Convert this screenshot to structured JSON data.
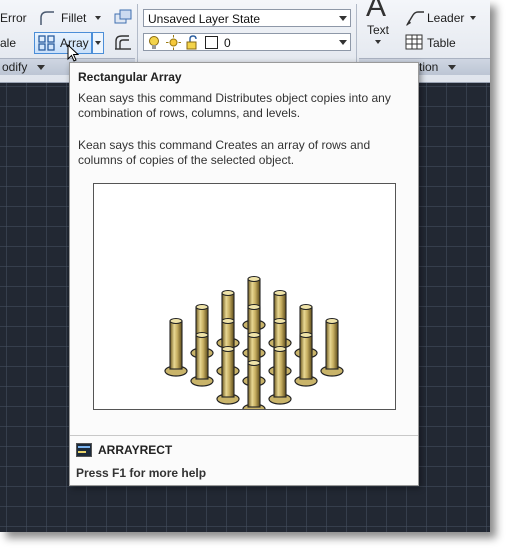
{
  "ribbon": {
    "mirror_label": "Error",
    "scale_label": "ale",
    "fillet_label": "Fillet",
    "array_label": "Array",
    "modify_panel": "odify",
    "layer_state": "Unsaved Layer State",
    "layer_current": "0",
    "text_label": "Text",
    "leader_label": "Leader",
    "table_label": "Table",
    "annotation_panel": "tion"
  },
  "tooltip": {
    "title": "Rectangular Array",
    "desc1": "Kean says this command Distributes object copies into any combination of rows, columns, and levels.",
    "desc2": "Kean says this command Creates an array of rows and columns of copies of the selected object.",
    "command": "ARRAYRECT",
    "help": "Press F1 for more help"
  },
  "colors": {
    "canvas": "#222833",
    "highlight": "#4b8ed8"
  }
}
